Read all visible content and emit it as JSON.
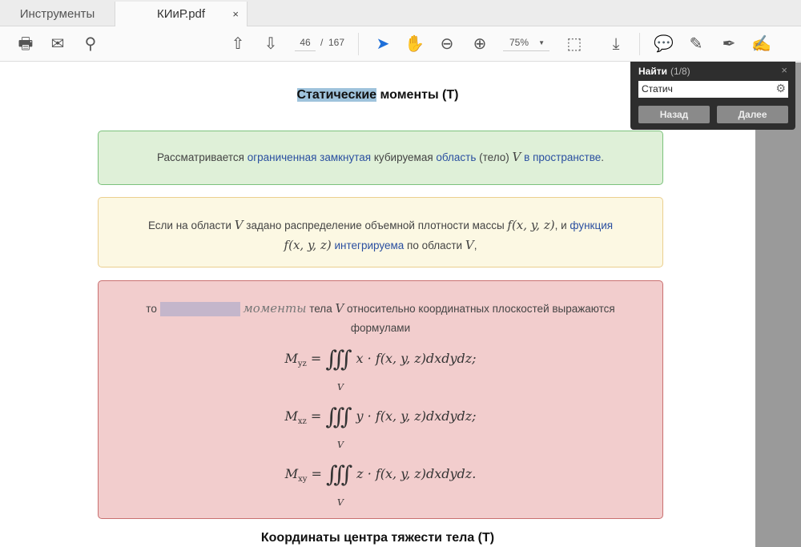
{
  "tabs": {
    "tools": "Инструменты",
    "file": "КИиР.pdf",
    "close": "×"
  },
  "toolbar": {
    "page_current": "46",
    "page_sep": "/",
    "page_total": "167",
    "zoom": "75%"
  },
  "find": {
    "title": "Найти",
    "count": "(1/8)",
    "query": "Статич",
    "back": "Назад",
    "next": "Далее",
    "close": "×"
  },
  "doc": {
    "heading_highlight": "Статические",
    "heading_rest": " моменты (Т)",
    "green": [
      "Рассматривается ",
      "ограниченная замкнутая",
      " кубируемая ",
      "область",
      " (тело) ",
      "V",
      " ",
      "в пространстве",
      "."
    ],
    "yellow_l1": [
      "Если на области ",
      "V",
      " задано распределение объемной плотности массы ",
      "f(x, y, z)",
      ", и ",
      "функция"
    ],
    "yellow_l2": [
      "f(x, y, z)",
      " ",
      "интегрируема",
      " по области ",
      "V",
      ","
    ],
    "red_l1": [
      "то",
      "моменты",
      " тела ",
      "V",
      " относительно координатных плоскостей выражаются"
    ],
    "red_l2": "формулами",
    "formulas": [
      {
        "lhs": "M",
        "sub": "yz",
        "rhs": "x · f(x, y, z)dxdydz;"
      },
      {
        "lhs": "M",
        "sub": "xz",
        "rhs": "y · f(x, y, z)dxdydz;"
      },
      {
        "lhs": "M",
        "sub": "xy",
        "rhs": "z · f(x, y, z)dxdydz."
      }
    ],
    "int_symbol": "∭",
    "int_domain": "V",
    "eq": " = ",
    "heading2": "Координаты центра тяжести тела (Т)"
  }
}
